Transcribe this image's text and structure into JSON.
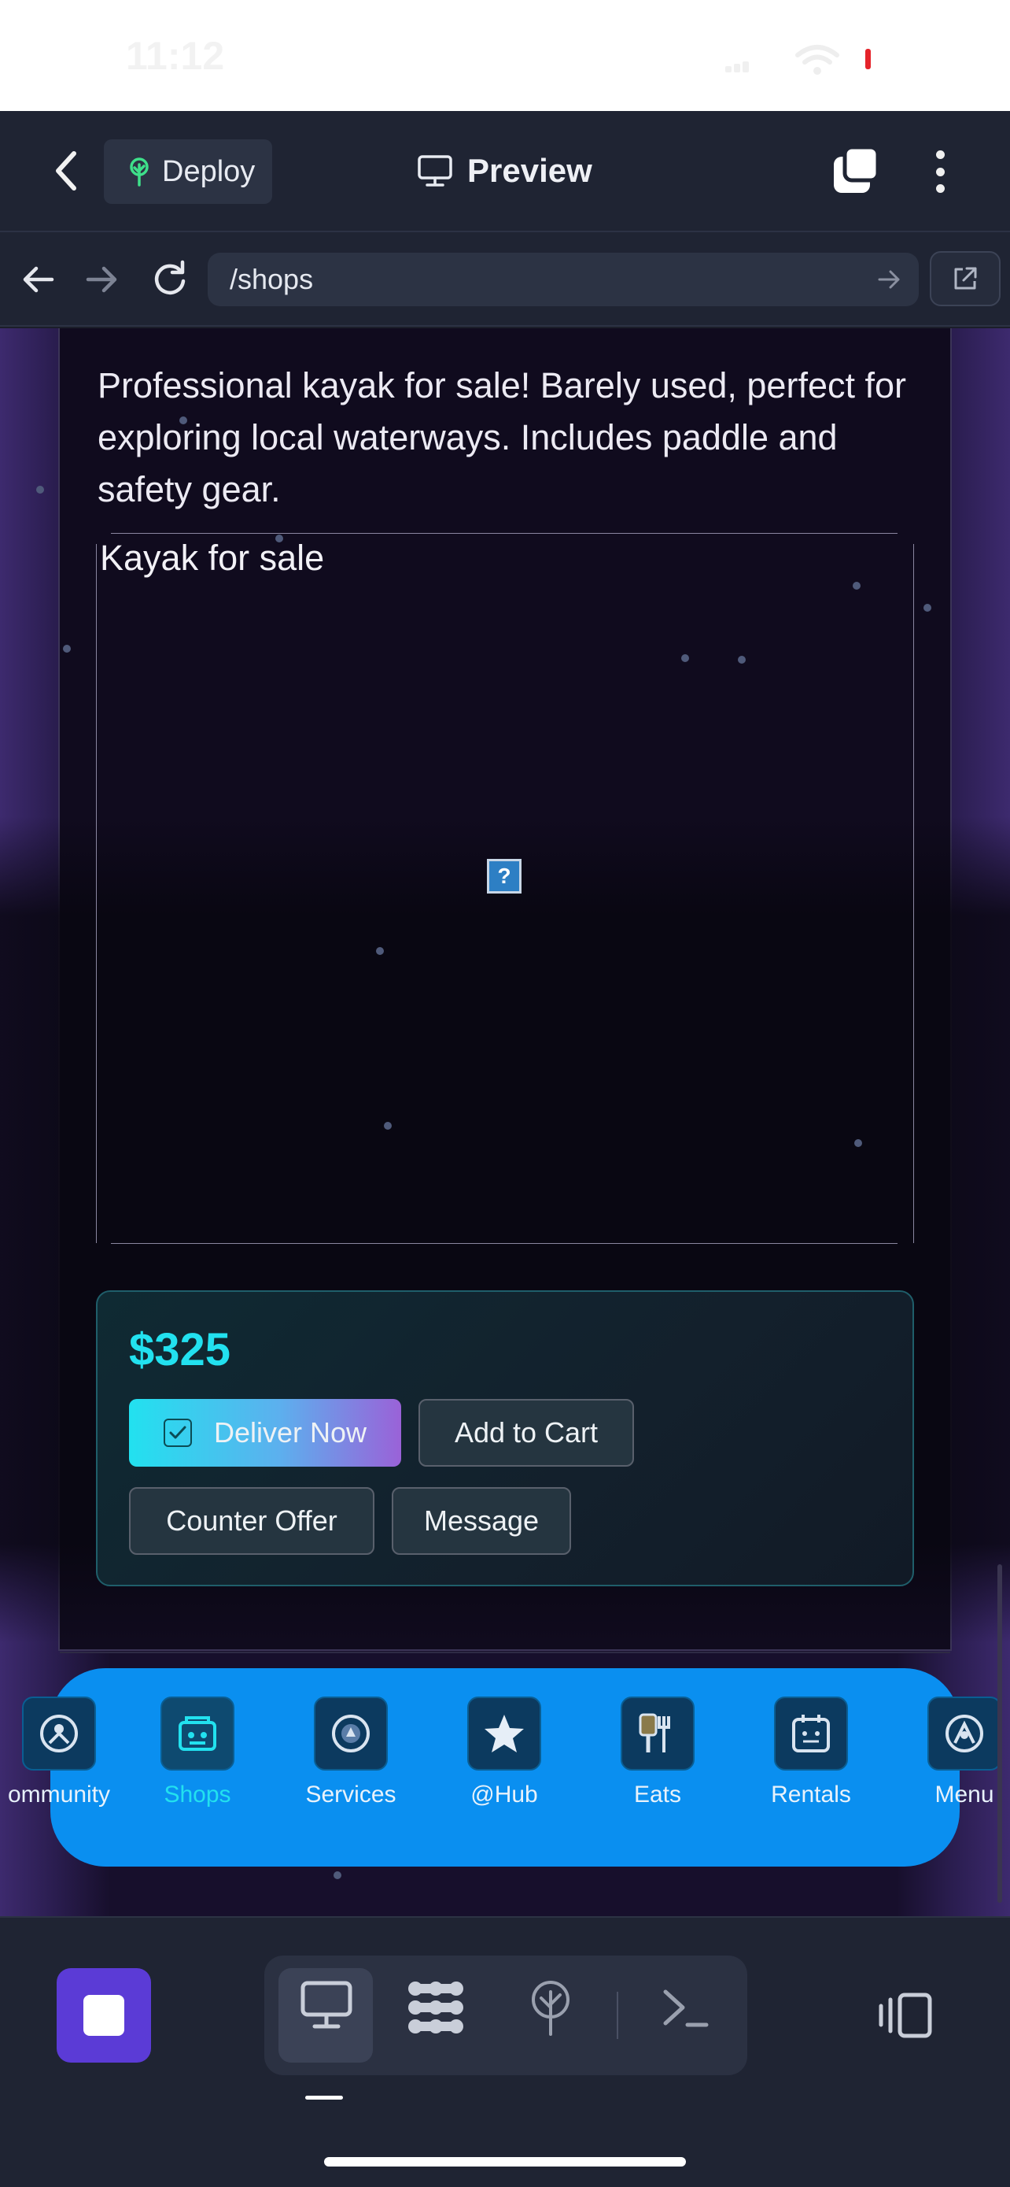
{
  "status_bar": {
    "time": "11:12"
  },
  "app_header": {
    "deploy_label": "Deploy",
    "title": "Preview"
  },
  "url_bar": {
    "url": "/shops"
  },
  "listing": {
    "description": "Professional kayak for sale! Barely used, perfect for exploring local waterways. Includes paddle and safety gear.",
    "image_alt": "Kayak for sale",
    "broken_image_glyph": "?",
    "price": "$325",
    "deliver_label": "Deliver Now",
    "add_to_cart_label": "Add to Cart",
    "counter_offer_label": "Counter Offer",
    "message_label": "Message",
    "colors": {
      "price": "#22e1ef",
      "deliver_gradient_start": "#22e1ef",
      "deliver_gradient_end": "#9a62d8"
    }
  },
  "dock": {
    "active": "Shops",
    "items": [
      {
        "label": "ommunity",
        "icon": "community-icon"
      },
      {
        "label": "Shops",
        "icon": "shop-icon"
      },
      {
        "label": "Services",
        "icon": "services-icon"
      },
      {
        "label": "@Hub",
        "icon": "star-icon"
      },
      {
        "label": "Eats",
        "icon": "eats-icon"
      },
      {
        "label": "Rentals",
        "icon": "calendar-icon"
      },
      {
        "label": "Menu",
        "icon": "menu-icon"
      }
    ],
    "color": "#0a8ff0"
  },
  "toolbar": {
    "stop_color": "#5b3bd6",
    "modes": [
      "desktop-preview-icon",
      "apps-grid-icon",
      "deploy-icon",
      "terminal-icon"
    ],
    "selected_mode": "desktop-preview-icon"
  }
}
